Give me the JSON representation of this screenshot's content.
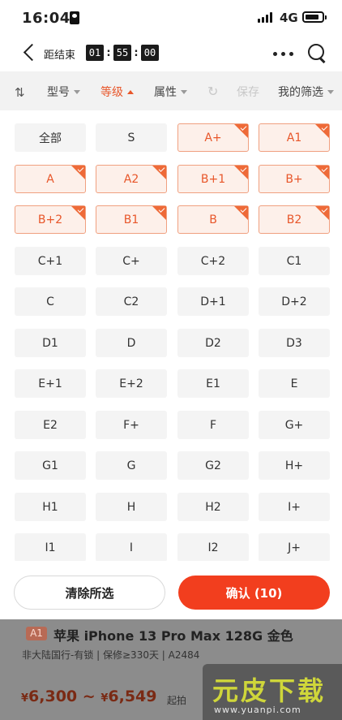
{
  "status_bar": {
    "time": "16:04",
    "network": "4G"
  },
  "nav": {
    "countdown_label": "距结束",
    "countdown": {
      "hours": "01",
      "minutes": "55",
      "seconds": "00"
    }
  },
  "filter_bar": {
    "model": "型号",
    "grade": "等级",
    "attribute": "属性",
    "save": "保存",
    "my_filters": "我的筛选"
  },
  "grades": [
    {
      "label": "全部",
      "selected": false
    },
    {
      "label": "S",
      "selected": false
    },
    {
      "label": "A+",
      "selected": true
    },
    {
      "label": "A1",
      "selected": true
    },
    {
      "label": "A",
      "selected": true
    },
    {
      "label": "A2",
      "selected": true
    },
    {
      "label": "B+1",
      "selected": true
    },
    {
      "label": "B+",
      "selected": true
    },
    {
      "label": "B+2",
      "selected": true
    },
    {
      "label": "B1",
      "selected": true
    },
    {
      "label": "B",
      "selected": true
    },
    {
      "label": "B2",
      "selected": true
    },
    {
      "label": "C+1",
      "selected": false
    },
    {
      "label": "C+",
      "selected": false
    },
    {
      "label": "C+2",
      "selected": false
    },
    {
      "label": "C1",
      "selected": false
    },
    {
      "label": "C",
      "selected": false
    },
    {
      "label": "C2",
      "selected": false
    },
    {
      "label": "D+1",
      "selected": false
    },
    {
      "label": "D+2",
      "selected": false
    },
    {
      "label": "D1",
      "selected": false
    },
    {
      "label": "D",
      "selected": false
    },
    {
      "label": "D2",
      "selected": false
    },
    {
      "label": "D3",
      "selected": false
    },
    {
      "label": "E+1",
      "selected": false
    },
    {
      "label": "E+2",
      "selected": false
    },
    {
      "label": "E1",
      "selected": false
    },
    {
      "label": "E",
      "selected": false
    },
    {
      "label": "E2",
      "selected": false
    },
    {
      "label": "F+",
      "selected": false
    },
    {
      "label": "F",
      "selected": false
    },
    {
      "label": "G+",
      "selected": false
    },
    {
      "label": "G1",
      "selected": false
    },
    {
      "label": "G",
      "selected": false
    },
    {
      "label": "G2",
      "selected": false
    },
    {
      "label": "H+",
      "selected": false
    },
    {
      "label": "H1",
      "selected": false
    },
    {
      "label": "H",
      "selected": false
    },
    {
      "label": "H2",
      "selected": false
    },
    {
      "label": "I+",
      "selected": false
    },
    {
      "label": "I1",
      "selected": false
    },
    {
      "label": "I",
      "selected": false
    },
    {
      "label": "I2",
      "selected": false
    },
    {
      "label": "J+",
      "selected": false
    }
  ],
  "actions": {
    "clear": "清除所选",
    "confirm": "确认 (10)"
  },
  "product": {
    "grade": "A1",
    "title": "苹果 iPhone 13 Pro Max 128G 金色",
    "subtitle": "非大陆国行-有锁 | 保修≥330天 | A2484",
    "price_low": "6,300",
    "price_high": "6,549",
    "currency": "¥",
    "price_separator": "~",
    "start_label": "起拍"
  },
  "watermark": {
    "text": "元皮下载",
    "url": "www.yuanpi.com"
  },
  "colors": {
    "accent": "#e8562a",
    "confirm": "#f23e1e"
  }
}
